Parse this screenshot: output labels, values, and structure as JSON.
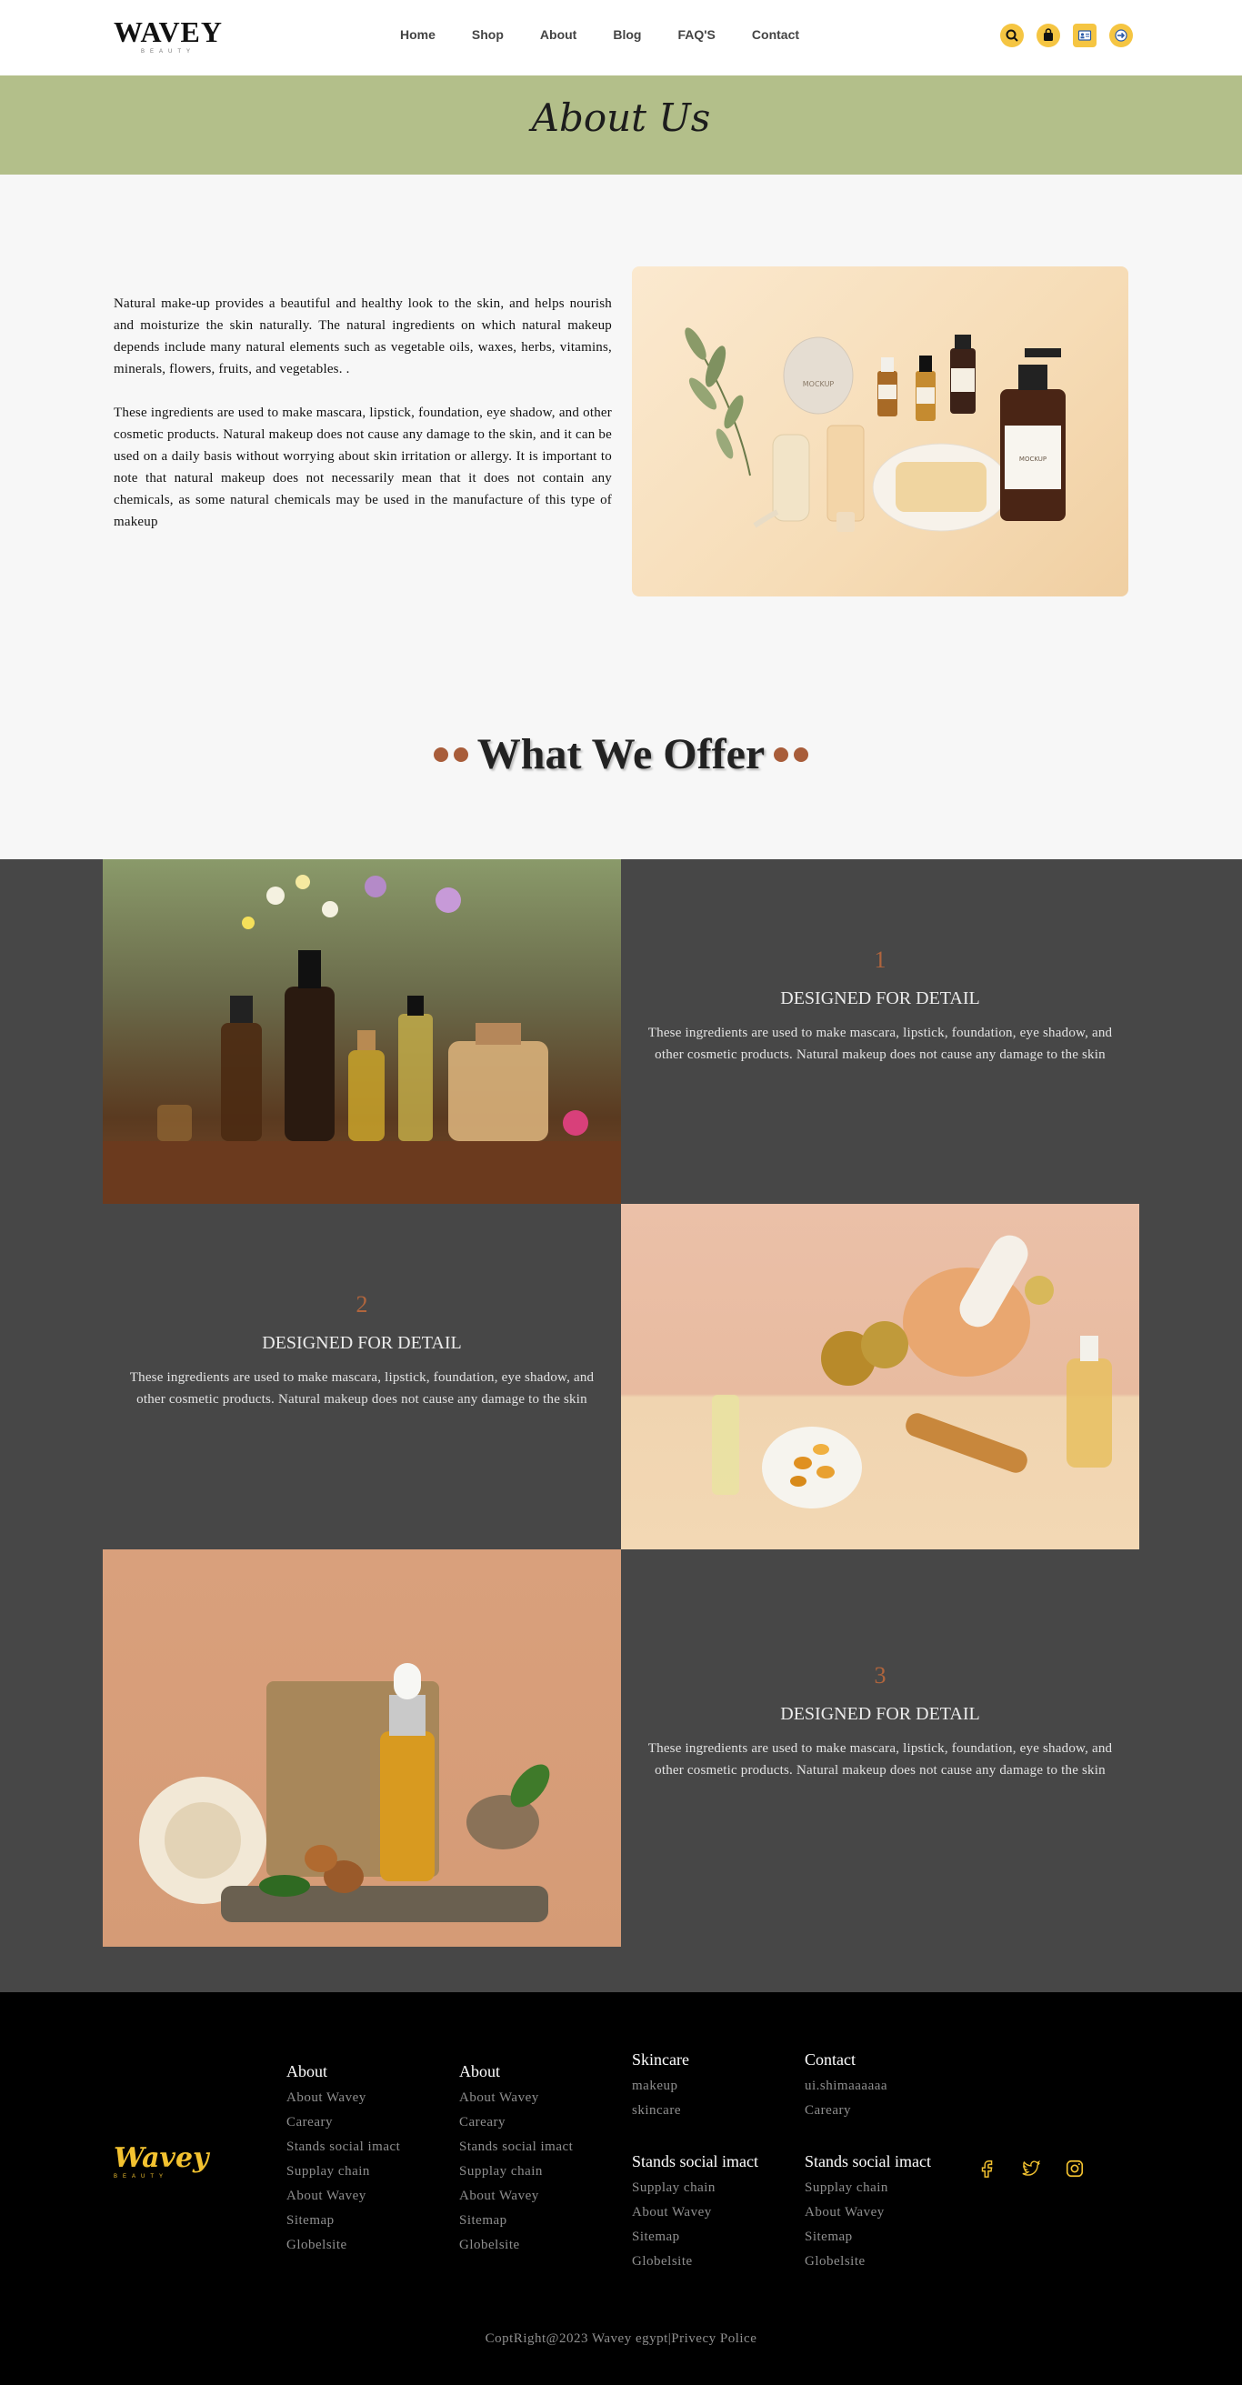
{
  "header": {
    "logo": "WAVEY",
    "logo_sub": "BEAUTY",
    "nav": [
      "Home",
      "Shop",
      "About",
      "Blog",
      "FAQ'S",
      "Contact"
    ],
    "icons": [
      "search-icon",
      "bag-icon",
      "profile-card-icon",
      "login-icon"
    ],
    "accent": "#f5c542"
  },
  "banner": {
    "title": "About Us",
    "color": "#b3bf8a"
  },
  "about": {
    "paragraph1": "Natural make-up provides a beautiful and healthy look to the skin, and helps nourish and moisturize the skin naturally. The natural ingredients on which natural makeup depends include many natural elements such as vegetable oils, waxes, herbs, vitamins, minerals, flowers, fruits, and vegetables. .",
    "paragraph2": "These ingredients are used to make mascara, lipstick, foundation, eye shadow, and other cosmetic products. Natural makeup does not cause any damage to the skin, and it can be used on a daily basis without worrying about skin irritation or allergy. It is important to note that natural makeup does not necessarily mean that it does not contain any chemicals, as some natural chemicals may be used in the manufacture of this type of makeup",
    "image_labels": [
      "MOCKUP",
      "MOCKUP",
      "MOCKUP"
    ]
  },
  "offer": {
    "title": "What We Offer",
    "accent": "#a85d3a",
    "items": [
      {
        "number": "1",
        "title": "DESIGNED FOR DETAIL",
        "desc": "These ingredients are used to make mascara, lipstick, foundation, eye shadow, and other cosmetic products. Natural makeup does not cause any damage to the skin"
      },
      {
        "number": "2",
        "title": "DESIGNED FOR DETAIL",
        "desc": "These ingredients are used to make mascara, lipstick, foundation, eye shadow, and other cosmetic products. Natural makeup does not cause any damage to the skin"
      },
      {
        "number": "3",
        "title": "DESIGNED FOR DETAIL",
        "desc": "These ingredients are used to make mascara, lipstick, foundation, eye shadow, and other cosmetic products. Natural makeup does not cause any damage to the skin"
      }
    ]
  },
  "footer": {
    "logo": "Wavey",
    "logo_sub": "BEAUTY",
    "logo_color": "#f3c230",
    "col1": {
      "heading": "About",
      "links": [
        "About Wavey",
        "Careary",
        "Stands social imact",
        "Supplay chain",
        "About Wavey",
        "Sitemap",
        "Globelsite"
      ]
    },
    "col2": {
      "heading": "About",
      "links": [
        "About Wavey",
        "Careary",
        "Stands social imact",
        "Supplay chain",
        "About Wavey",
        "Sitemap",
        "Globelsite"
      ]
    },
    "col3a": {
      "heading": "Skincare",
      "links": [
        "makeup",
        "skincare"
      ]
    },
    "col3b": {
      "heading": "Stands social imact",
      "links": [
        "Supplay chain",
        "About Wavey",
        "Sitemap",
        "Globelsite"
      ]
    },
    "col4a": {
      "heading": "Contact",
      "links": [
        "ui.shimaaaaaa",
        "Careary"
      ]
    },
    "col4b": {
      "heading": "Stands social imact",
      "links": [
        "Supplay chain",
        "About Wavey",
        "Sitemap",
        "Globelsite"
      ]
    },
    "socials": [
      "facebook-icon",
      "twitter-icon",
      "instagram-icon"
    ],
    "copyright": "CoptRight@2023 Wavey egypt|Privecy Police"
  }
}
